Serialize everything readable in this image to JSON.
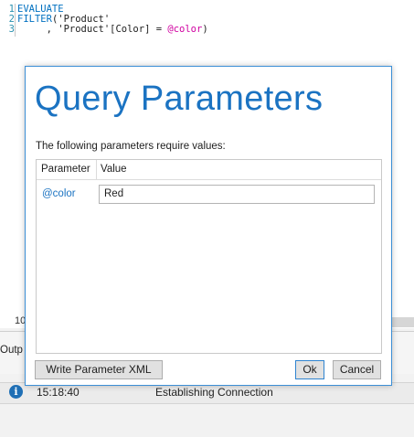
{
  "editor": {
    "lines": [
      {
        "number": "1",
        "parts": [
          {
            "text": "EVALUATE",
            "cls": "kw"
          }
        ]
      },
      {
        "number": "2",
        "parts": [
          {
            "text": "FILTER",
            "cls": "kw"
          },
          {
            "text": "('Product'",
            "cls": ""
          }
        ]
      },
      {
        "number": "3",
        "parts": [
          {
            "text": "     , 'Product'[Color] = ",
            "cls": ""
          },
          {
            "text": "@color",
            "cls": "param"
          },
          {
            "text": ")",
            "cls": ""
          }
        ]
      }
    ],
    "partial_line_number": "10"
  },
  "output": {
    "tab_label": "Outp"
  },
  "status": {
    "icon": "info-icon",
    "time": "15:18:40",
    "message": "Establishing Connection"
  },
  "dialog": {
    "title": "Query Parameters",
    "instruction": "The following parameters require values:",
    "columns": [
      "Parameter",
      "Value"
    ],
    "parameters": [
      {
        "name": "@color",
        "value": "Red"
      }
    ],
    "buttons": {
      "write_xml": "Write Parameter XML",
      "ok": "Ok",
      "cancel": "Cancel"
    },
    "accent_color": "#1b73c2"
  }
}
